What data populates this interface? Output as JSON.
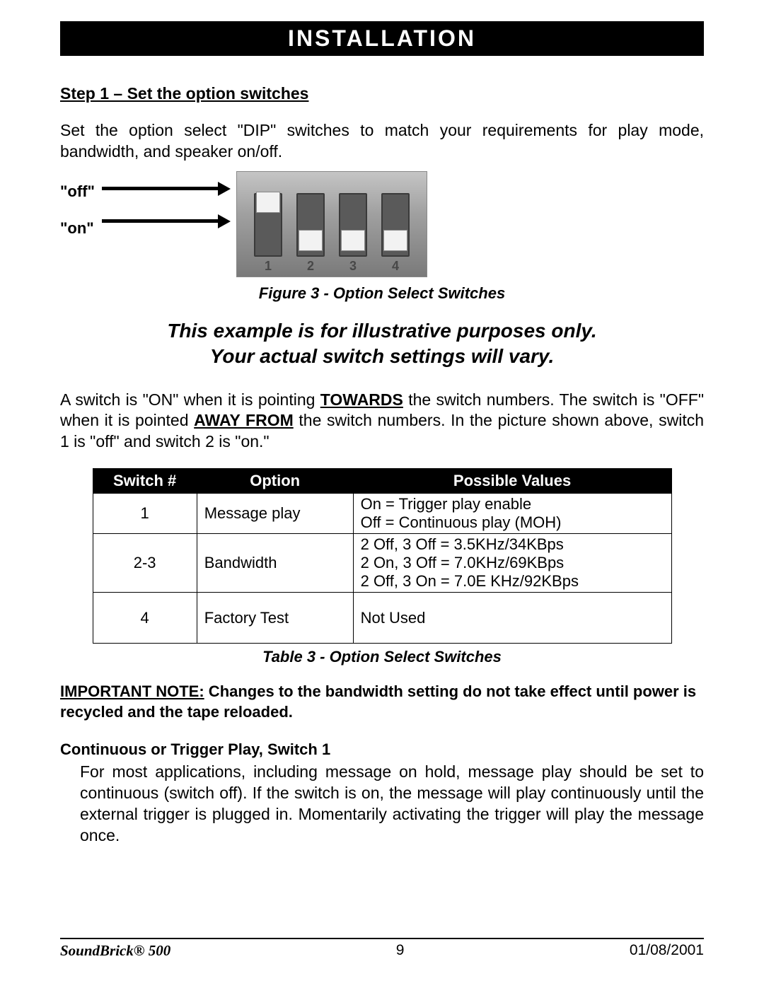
{
  "banner": "INSTALLATION",
  "step1": {
    "heading": "Step 1 – Set the option switches",
    "intro": "Set the option select \"DIP\" switches to match your requirements for play mode, bandwidth, and speaker on/off.",
    "label_off": "\"off\"",
    "label_on": "\"on\"",
    "figure_caption": "Figure 3 - Option Select Switches",
    "illustrative_line1": "This example is for illustrative purposes only.",
    "illustrative_line2": "Your actual switch settings will vary.",
    "switch_desc_pre": "A switch is \"ON\" when it is pointing ",
    "towards": "TOWARDS",
    "switch_desc_mid": " the switch numbers. The switch is \"OFF\" when it is pointed ",
    "away_from": "AWAY FROM",
    "switch_desc_post": " the switch numbers. In the picture shown above, switch 1 is \"off\" and switch 2 is \"on.\"",
    "table": {
      "headers": [
        "Switch #",
        "Option",
        "Possible Values"
      ],
      "rows": [
        {
          "num": "1",
          "option": "Message play",
          "values_html": [
            "On = Trigger play enable",
            "Off = Continuous play (MOH)"
          ]
        },
        {
          "num": "2-3",
          "option": "Bandwidth",
          "values_html": [
            "2 Off, 3 Off = 3.5KHz/34KBps",
            "2 On, 3 Off = 7.0KHz/69KBps",
            "2 Off, 3 On = 7.0E KHz/92KBps"
          ]
        },
        {
          "num": "4",
          "option": "Factory Test",
          "values_html": [
            "Not Used"
          ]
        }
      ]
    },
    "table_caption": "Table 3 - Option Select Switches",
    "important_label": "IMPORTANT NOTE:",
    "important_text": "  Changes to the bandwidth setting do not take effect until power is recycled and the tape reloaded.",
    "continuous_heading": "Continuous or Trigger Play, Switch 1",
    "continuous_body": "For most applications, including message on hold, message play should be set to continuous (switch off).  If the switch is on, the message will play continuously until the external trigger is plugged in.  Momentarily activating the trigger will play the message once."
  },
  "footer": {
    "product": "SoundBrick® 500",
    "page": "9",
    "date": "01/08/2001"
  },
  "dip": {
    "positions": [
      "up",
      "down",
      "down",
      "down"
    ],
    "numbers": [
      "1",
      "2",
      "3",
      "4"
    ]
  }
}
